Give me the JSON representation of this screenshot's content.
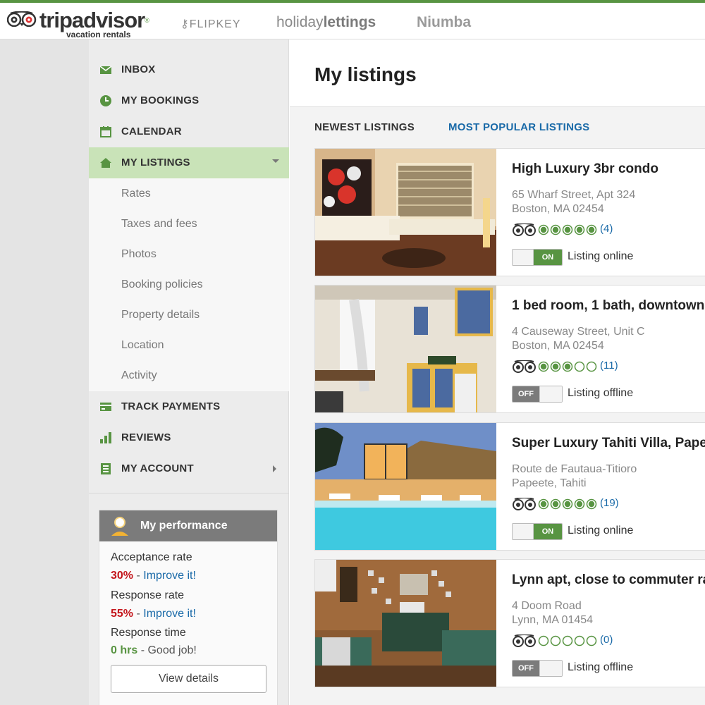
{
  "brand": {
    "name": "tripadvisor",
    "reg": "®",
    "tagline": "vacation rentals"
  },
  "partners": [
    "FLIPKEY",
    "holiday",
    "lettings",
    "Niumba"
  ],
  "nav": {
    "inbox": "INBOX",
    "bookings": "MY BOOKINGS",
    "calendar": "CALENDAR",
    "listings": "MY LISTINGS",
    "sub": [
      "Rates",
      "Taxes and fees",
      "Photos",
      "Booking policies",
      "Property details",
      "Location",
      "Activity"
    ],
    "payments": "TRACK PAYMENTS",
    "reviews": "REVIEWS",
    "account": "MY ACCOUNT"
  },
  "performance": {
    "title": "My performance",
    "acceptance": {
      "label": "Acceptance rate",
      "value": "30%",
      "sep": " - ",
      "note": "Improve it!"
    },
    "response": {
      "label": "Response rate",
      "value": "55%",
      "sep": " - ",
      "note": "Improve it!"
    },
    "time": {
      "label": "Response time",
      "value": "0 hrs",
      "sep": " - ",
      "note": "Good job!"
    },
    "button": "View details"
  },
  "main": {
    "title": "My listings",
    "tabs": {
      "newest": "NEWEST LISTINGS",
      "popular": "MOST POPULAR LISTINGS"
    }
  },
  "listings": [
    {
      "title": "High Luxury 3br condo",
      "addr1": "65 Wharf Street, Apt 324",
      "addr2": "Boston, MA 02454",
      "rating": 5,
      "count": "(4)",
      "toggle": "ON",
      "status": "Listing online"
    },
    {
      "title": "1 bed room, 1 bath, downtown",
      "addr1": "4 Causeway Street, Unit C",
      "addr2": "Boston, MA 02454",
      "rating": 3,
      "count": "(11)",
      "toggle": "OFF",
      "status": "Listing offline"
    },
    {
      "title": "Super Luxury Tahiti Villa, Papeete",
      "addr1": "Route de Fautaua-Titioro",
      "addr2": "Papeete, Tahiti",
      "rating": 5,
      "count": "(19)",
      "toggle": "ON",
      "status": "Listing online"
    },
    {
      "title": "Lynn apt, close to commuter rail",
      "addr1": "4 Doom Road",
      "addr2": "Lynn, MA 01454",
      "rating": 0,
      "count": "(0)",
      "toggle": "OFF",
      "status": "Listing offline"
    }
  ],
  "colors": {
    "accent": "#589442",
    "link": "#1a6aa8",
    "alert": "#c4161c"
  }
}
